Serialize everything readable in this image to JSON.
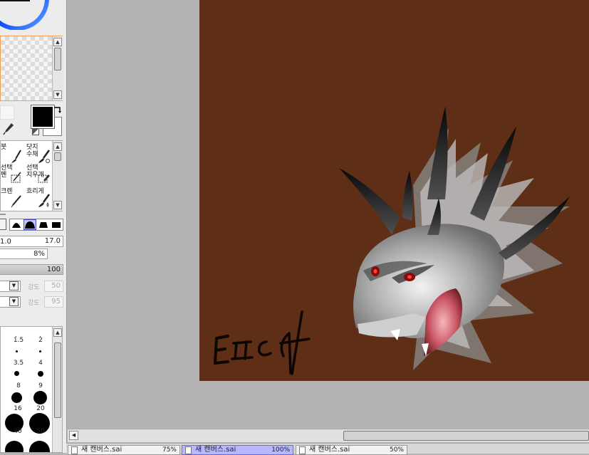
{
  "tools": [
    {
      "label": "붓",
      "icon": "brush-icon"
    },
    {
      "label": "닷지\n수채",
      "icon": "watercolor-brush-icon"
    },
    {
      "label": "선택\n펜",
      "icon": "selection-pen-icon"
    },
    {
      "label": "선택\n지우개",
      "icon": "selection-eraser-icon"
    },
    {
      "label": "크렌",
      "icon": "crayon-icon"
    },
    {
      "label": "흐리게",
      "icon": "blur-icon"
    }
  ],
  "brush": {
    "min_size": "1.0",
    "size": "17.0",
    "min_density_percent": "8%",
    "density": "100",
    "strength_label": "강도",
    "strength_1": "50",
    "strength_2": "95"
  },
  "brush_sizes": [
    "1.5",
    "2",
    "3.5",
    "4",
    "8",
    "9",
    "16",
    "20",
    "40",
    "50"
  ],
  "tabs": [
    {
      "name": "새 캔버스.sai",
      "zoom": "75%",
      "active": false
    },
    {
      "name": "새 캔버스.sai",
      "zoom": "100%",
      "active": true
    },
    {
      "name": "새 캔버스.sai",
      "zoom": "50%",
      "active": false
    }
  ],
  "canvas": {
    "background": "#5e2e17",
    "signature": "EICH"
  },
  "colors": {
    "primary": "#000000",
    "secondary": "#ffffff",
    "workspace": "#b4b4b4"
  }
}
